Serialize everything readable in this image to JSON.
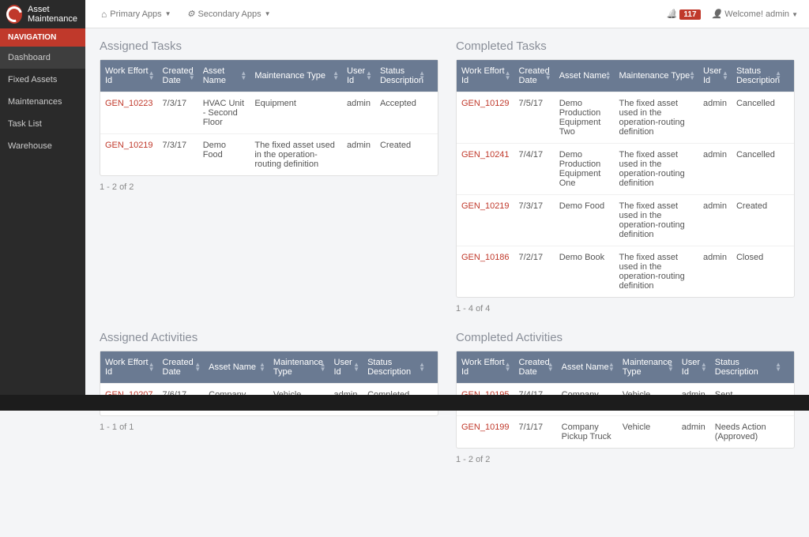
{
  "brand": "Asset Maintenance",
  "topnav": {
    "primary": "Primary Apps",
    "secondary": "Secondary Apps"
  },
  "notifications": "117",
  "welcome": {
    "text": "Welcome! admin"
  },
  "sidebar": {
    "heading": "NAVIGATION",
    "items": [
      "Dashboard",
      "Fixed Assets",
      "Maintenances",
      "Task List",
      "Warehouse"
    ]
  },
  "headers": {
    "workEffort": "Work Effort Id",
    "created": "Created Date",
    "asset": "Asset Name",
    "maint": "Maintenance Type",
    "user": "User Id",
    "status": "Status Description"
  },
  "assignedTasks": {
    "title": "Assigned Tasks",
    "rows": [
      {
        "id": "GEN_10223",
        "date": "7/3/17",
        "asset": "HVAC Unit - Second Floor",
        "maint": "Equipment",
        "user": "admin",
        "status": "Accepted"
      },
      {
        "id": "GEN_10219",
        "date": "7/3/17",
        "asset": "Demo Food",
        "maint": "The fixed asset used in the operation-routing definition",
        "user": "admin",
        "status": "Created"
      }
    ],
    "pager": "1 - 2 of 2"
  },
  "completedTasks": {
    "title": "Completed Tasks",
    "rows": [
      {
        "id": "GEN_10129",
        "date": "7/5/17",
        "asset": "Demo Production Equipment Two",
        "maint": "The fixed asset used in the operation-routing definition",
        "user": "admin",
        "status": "Cancelled"
      },
      {
        "id": "GEN_10241",
        "date": "7/4/17",
        "asset": "Demo Production Equipment One",
        "maint": "The fixed asset used in the operation-routing definition",
        "user": "admin",
        "status": "Cancelled"
      },
      {
        "id": "GEN_10219",
        "date": "7/3/17",
        "asset": "Demo Food",
        "maint": "The fixed asset used in the operation-routing definition",
        "user": "admin",
        "status": "Created"
      },
      {
        "id": "GEN_10186",
        "date": "7/2/17",
        "asset": "Demo Book",
        "maint": "The fixed asset used in the operation-routing definition",
        "user": "admin",
        "status": "Closed"
      }
    ],
    "pager": "1 - 4 of 4"
  },
  "assignedActivities": {
    "title": "Assigned Activities",
    "rows": [
      {
        "id": "GEN_10207",
        "date": "7/6/17",
        "asset": "Company Pickup Truck",
        "maint": "Vehicle",
        "user": "admin",
        "status": "Completed"
      }
    ],
    "pager": "1 - 1 of 1"
  },
  "completedActivities": {
    "title": "Completed Activities",
    "rows": [
      {
        "id": "GEN_10195",
        "date": "7/4/17",
        "asset": "Company Delivery Van",
        "maint": "Vehicle",
        "user": "admin",
        "status": "Sent"
      },
      {
        "id": "GEN_10199",
        "date": "7/1/17",
        "asset": "Company Pickup Truck",
        "maint": "Vehicle",
        "user": "admin",
        "status": "Needs Action (Approved)"
      }
    ],
    "pager": "1 - 2 of 2"
  }
}
